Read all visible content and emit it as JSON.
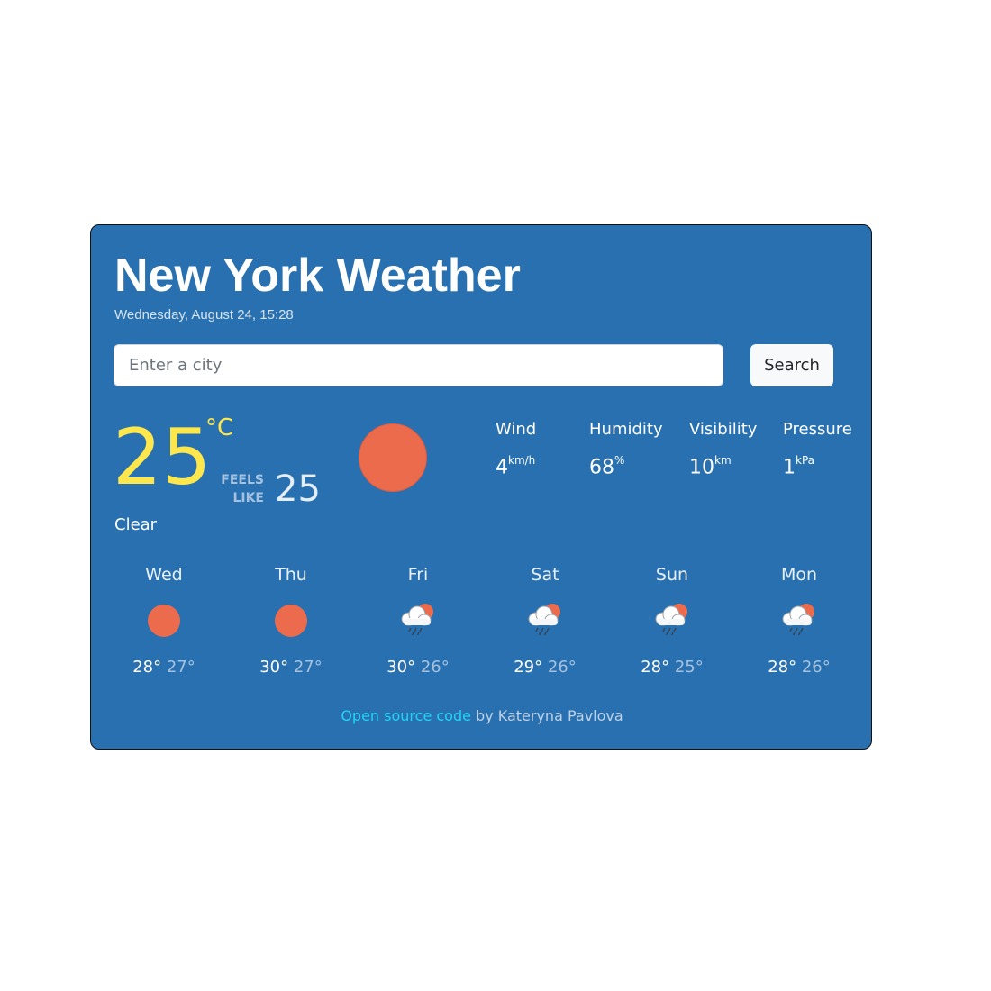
{
  "header": {
    "title": "New York Weather",
    "date": "Wednesday, August 24, 15:28"
  },
  "search": {
    "placeholder": "Enter a city",
    "value": "",
    "button_label": "Search"
  },
  "current": {
    "temperature": "25",
    "unit": "°C",
    "feels_like_label_1": "FEELS",
    "feels_like_label_2": "LIKE",
    "feels_like_value": "25",
    "condition": "Clear",
    "icon": "sun-icon"
  },
  "stats": [
    {
      "label": "Wind",
      "value": "4",
      "unit": "km/h"
    },
    {
      "label": "Humidity",
      "value": "68",
      "unit": "%"
    },
    {
      "label": "Visibility",
      "value": "10",
      "unit": "km"
    },
    {
      "label": "Pressure",
      "value": "1",
      "unit": "kPa"
    }
  ],
  "forecast": [
    {
      "day": "Wed",
      "icon": "sun-icon",
      "max": "28°",
      "min": "27°"
    },
    {
      "day": "Thu",
      "icon": "sun-icon",
      "max": "30°",
      "min": "27°"
    },
    {
      "day": "Fri",
      "icon": "rain-cloud-sun-icon",
      "max": "30°",
      "min": "26°"
    },
    {
      "day": "Sat",
      "icon": "rain-cloud-sun-icon",
      "max": "29°",
      "min": "26°"
    },
    {
      "day": "Sun",
      "icon": "rain-cloud-sun-icon",
      "max": "28°",
      "min": "25°"
    },
    {
      "day": "Mon",
      "icon": "rain-cloud-sun-icon",
      "max": "28°",
      "min": "26°"
    }
  ],
  "footer": {
    "link_text": "Open source code",
    "suffix": " by Kateryna Pavlova"
  },
  "colors": {
    "card_background": "#2870b0",
    "temperature": "#fde74c",
    "sun": "#ed6b4d",
    "link": "#22d3f5"
  }
}
